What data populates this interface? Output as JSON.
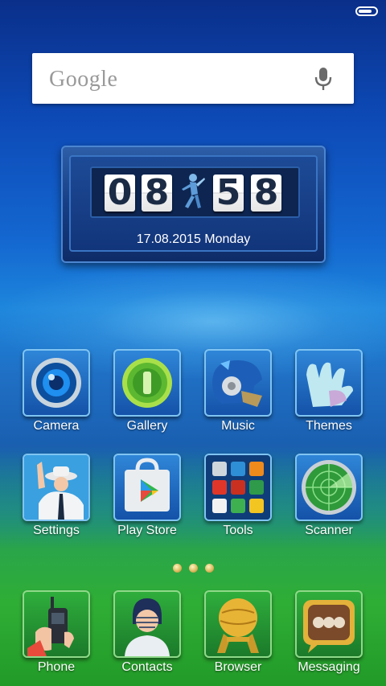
{
  "status_bar": {
    "battery_icon": "battery-icon"
  },
  "search": {
    "logo": "Google",
    "mic_icon": "mic-icon"
  },
  "clock": {
    "hour_tens": "0",
    "hour_ones": "8",
    "minute_tens": "5",
    "minute_ones": "8",
    "date": "17.08.2015  Monday"
  },
  "apps": [
    {
      "label": "Camera",
      "icon": "camera-icon"
    },
    {
      "label": "Gallery",
      "icon": "gallery-icon"
    },
    {
      "label": "Music",
      "icon": "music-icon"
    },
    {
      "label": "Themes",
      "icon": "themes-icon"
    },
    {
      "label": "Settings",
      "icon": "settings-icon"
    },
    {
      "label": "Play Store",
      "icon": "play-store-icon"
    },
    {
      "label": "Tools",
      "icon": "tools-icon"
    },
    {
      "label": "Scanner",
      "icon": "scanner-icon"
    }
  ],
  "page_indicator": {
    "count": 3,
    "active": 1
  },
  "dock": [
    {
      "label": "Phone",
      "icon": "phone-icon"
    },
    {
      "label": "Contacts",
      "icon": "contacts-icon"
    },
    {
      "label": "Browser",
      "icon": "browser-icon"
    },
    {
      "label": "Messaging",
      "icon": "messaging-icon"
    }
  ]
}
